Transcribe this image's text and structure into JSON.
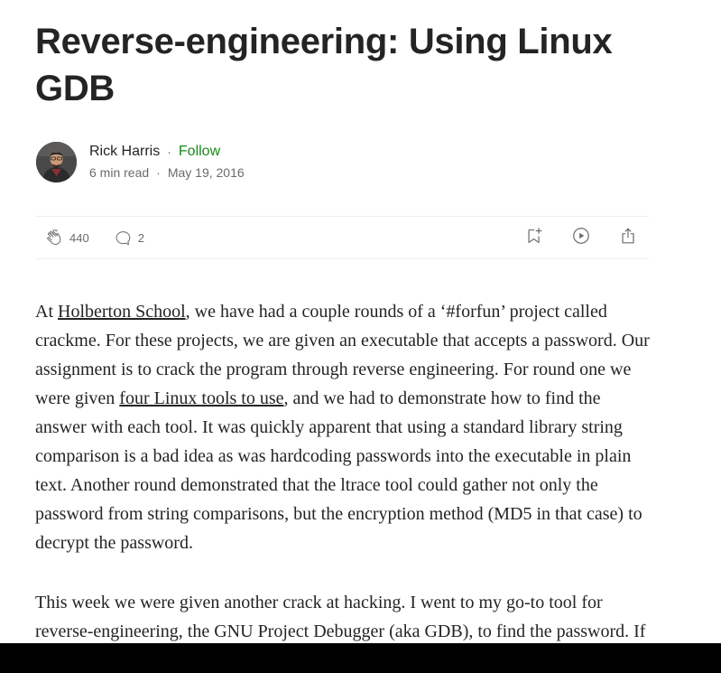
{
  "article": {
    "title": "Reverse-engineering: Using Linux GDB"
  },
  "author": {
    "name": "Rick Harris",
    "follow_label": "Follow",
    "separator": "·",
    "read_time": "6 min read",
    "date": "May 19, 2016"
  },
  "actions": {
    "claps": "440",
    "responses": "2",
    "icons": [
      "clap-icon",
      "comment-icon",
      "bookmark-add-icon",
      "play-listen-icon",
      "share-icon"
    ]
  },
  "body": {
    "p1": {
      "t1": "At ",
      "link1": "Holberton School",
      "t2": ", we have had a couple rounds of a ‘#forfun’ project called crackme. For these projects, we are given an executable that accepts a password. Our assignment is to crack the program through reverse engineering. For round one we were given ",
      "link2": "four Linux tools to use",
      "t3": ", and we had to demonstrate how to find the answer with each tool. It was quickly apparent that using a standard library string comparison is a bad idea as was hardcoding passwords into the executable in plain text. Another round demonstrated that the ltrace tool could gather not only the password from string comparisons, but the encryption method (MD5 in that case) to decrypt the password."
    },
    "p2": "This week we were given another crack at hacking. I went to my go-to tool for reverse-engineering, the GNU Project Debugger (aka GDB), to find the password. If"
  },
  "colors": {
    "text": "#242424",
    "muted": "#6b6b6b",
    "follow": "#1a8917",
    "divider": "#f0f0f0"
  }
}
